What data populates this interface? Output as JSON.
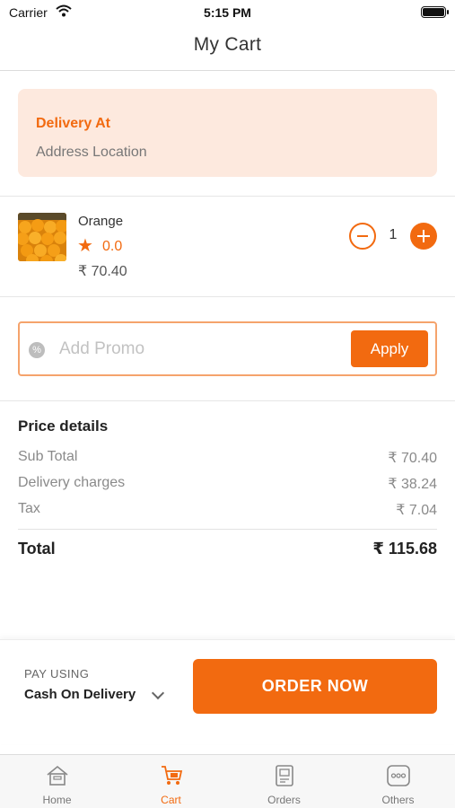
{
  "status_bar": {
    "carrier": "Carrier",
    "time": "5:15 PM"
  },
  "header": {
    "title": "My Cart"
  },
  "delivery": {
    "title": "Delivery At",
    "address": "Address Location"
  },
  "cart_items": [
    {
      "name": "Orange",
      "rating": "0.0",
      "price": "₹ 70.40",
      "quantity": "1"
    }
  ],
  "promo": {
    "placeholder": "Add Promo",
    "value": "",
    "apply_label": "Apply"
  },
  "price_details": {
    "heading": "Price details",
    "rows": [
      {
        "label": "Sub Total",
        "value": "₹ 70.40"
      },
      {
        "label": "Delivery charges",
        "value": "₹ 38.24"
      },
      {
        "label": "Tax",
        "value": "₹ 7.04"
      }
    ],
    "total_label": "Total",
    "total_value": "₹ 115.68"
  },
  "payment": {
    "label": "PAY USING",
    "method": "Cash On Delivery",
    "order_button": "ORDER NOW"
  },
  "tabs": [
    {
      "label": "Home",
      "icon": "home-icon",
      "active": false
    },
    {
      "label": "Cart",
      "icon": "cart-icon",
      "active": true
    },
    {
      "label": "Orders",
      "icon": "orders-icon",
      "active": false
    },
    {
      "label": "Others",
      "icon": "more-icon",
      "active": false
    }
  ],
  "colors": {
    "accent": "#f26a10",
    "delivery_bg": "#fde9de",
    "promo_border": "#f5a36c"
  }
}
